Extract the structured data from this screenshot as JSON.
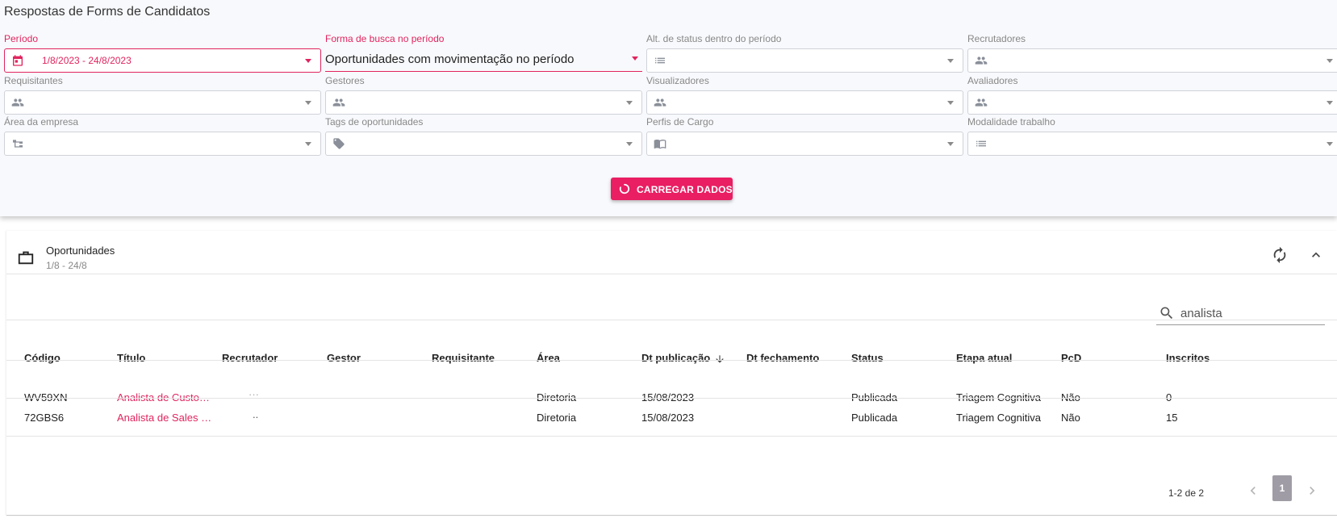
{
  "page": {
    "title": "Respostas de Forms de Candidatos"
  },
  "filters": {
    "periodo": {
      "label": "Período",
      "value": "1/8/2023 - 24/8/2023"
    },
    "forma_busca": {
      "label": "Forma de busca no período",
      "value": "Oportunidades com movimentação no período"
    },
    "alt_status": {
      "label": "Alt. de status dentro do período"
    },
    "recrutadores": {
      "label": "Recrutadores"
    },
    "requisitantes": {
      "label": "Requisitantes"
    },
    "gestores": {
      "label": "Gestores"
    },
    "visualizadores": {
      "label": "Visualizadores"
    },
    "avaliadores": {
      "label": "Avaliadores"
    },
    "area_empresa": {
      "label": "Área da empresa"
    },
    "tags_oportunidades": {
      "label": "Tags de oportunidades"
    },
    "perfis_cargo": {
      "label": "Perfis de Cargo"
    },
    "modalidade_trabalho": {
      "label": "Modalidade trabalho"
    }
  },
  "load_button": {
    "label": "CARREGAR DADOS"
  },
  "card": {
    "title": "Oportunidades",
    "subtitle": "1/8 - 24/8",
    "search": {
      "value": "analista"
    }
  },
  "table": {
    "headers": {
      "codigo": "Código",
      "titulo": "Título",
      "recrutador": "Recrutador",
      "gestor": "Gestor",
      "requisitante": "Requisitante",
      "area": "Área",
      "dt_publicacao": "Dt publicação",
      "dt_fechamento": "Dt fechamento",
      "status": "Status",
      "etapa_atual": "Etapa atual",
      "pcd": "PcD",
      "inscritos": "Inscritos"
    },
    "rows": [
      {
        "codigo": "WV59XN",
        "titulo": "Analista de Custo…",
        "recrutador": "···",
        "gestor": "",
        "requisitante": "",
        "area": "Diretoria",
        "dt_publicacao": "15/08/2023",
        "dt_fechamento": "",
        "status": "Publicada",
        "etapa_atual": "Triagem Cognitiva",
        "pcd": "Não",
        "inscritos": "0"
      },
      {
        "codigo": "72GBS6",
        "titulo": "Analista de Sales …",
        "recrutador": "..",
        "gestor": "",
        "requisitante": "",
        "area": "Diretoria",
        "dt_publicacao": "15/08/2023",
        "dt_fechamento": "",
        "status": "Publicada",
        "etapa_atual": "Triagem Cognitiva",
        "pcd": "Não",
        "inscritos": "15"
      }
    ]
  },
  "pagination": {
    "range": "1-2 de 2",
    "current_page": "1"
  },
  "colors": {
    "accent": "#e91e63",
    "accent_text": "#e0245e",
    "border": "#cfd2d8",
    "panel_bg": "#f8f9fc"
  },
  "icons": {
    "periodo": "calendar-icon",
    "alt_status": "list-icon",
    "people": "people-icon",
    "area_empresa": "tree-icon",
    "tags": "tag-icon",
    "perfis_cargo": "book-icon",
    "modalidade": "list-icon",
    "card": "briefcase-icon",
    "refresh": "refresh-icon",
    "collapse": "chevron-up-icon",
    "search": "search-icon",
    "sort": "arrow-down-icon"
  }
}
